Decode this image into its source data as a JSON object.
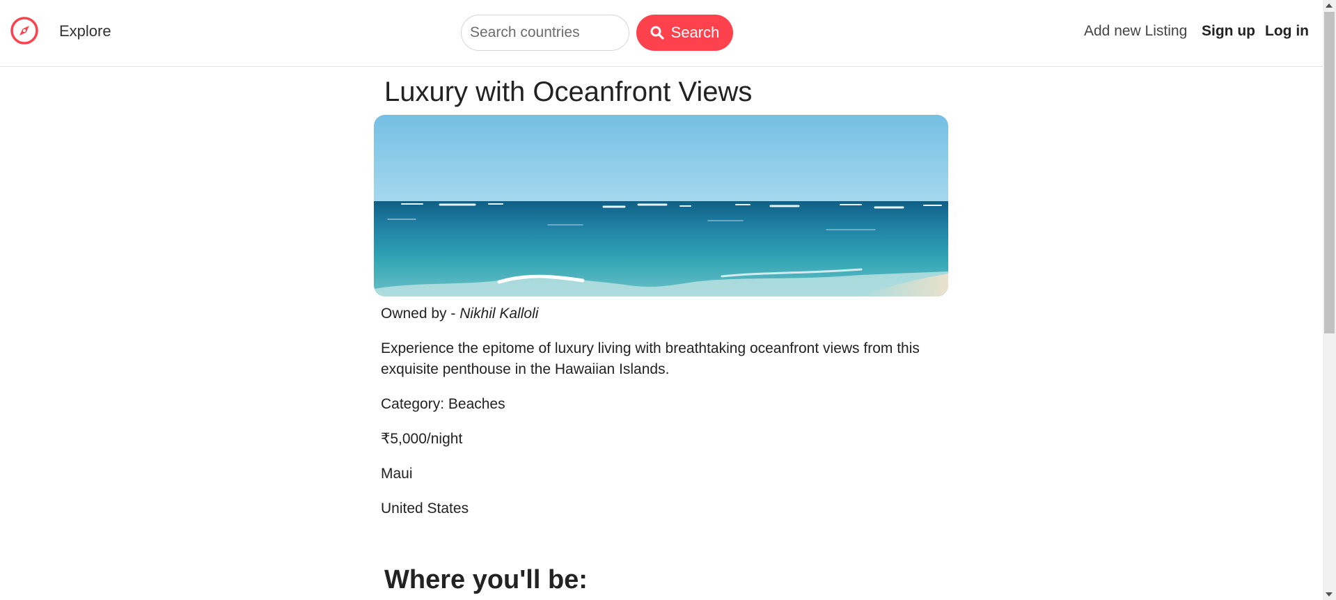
{
  "nav": {
    "explore_label": "Explore",
    "search_placeholder": "Search countries",
    "search_button_label": "Search",
    "add_listing_label": "Add new Listing",
    "signup_label": "Sign up",
    "login_label": "Log in",
    "brand_color": "#fe424d"
  },
  "listing": {
    "title": "Luxury with Oceanfront Views",
    "owned_by_prefix": "Owned by - ",
    "owner_name": "Nikhil Kalloli",
    "description": "Experience the epitome of luxury living with breathtaking oceanfront views from this exquisite penthouse in the Hawaiian Islands.",
    "category": "Category: Beaches",
    "price": "₹5,000/night",
    "location": "Maui",
    "country": "United States"
  },
  "map_section": {
    "heading": "Where you'll be:"
  }
}
